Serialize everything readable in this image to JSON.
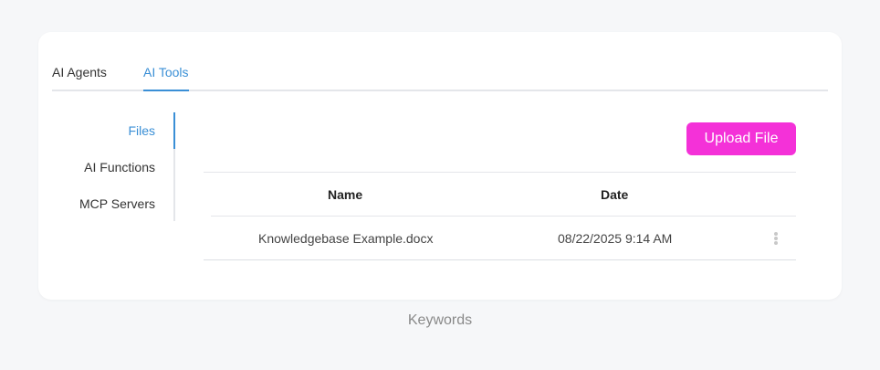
{
  "tabs": [
    {
      "label": "AI Agents",
      "active": false
    },
    {
      "label": "AI Tools",
      "active": true
    }
  ],
  "side_nav": {
    "items": [
      {
        "label": "Files",
        "active": true
      },
      {
        "label": "AI Functions",
        "active": false
      },
      {
        "label": "MCP Servers",
        "active": false
      }
    ]
  },
  "toolbar": {
    "upload_label": "Upload File"
  },
  "table": {
    "columns": [
      "Name",
      "Date"
    ],
    "rows": [
      {
        "name": "Knowledgebase Example.docx",
        "date": "08/22/2025 9:14 AM",
        "menu_icon": "vertical-ellipsis-icon"
      }
    ]
  },
  "footer": {
    "label": "Keywords"
  },
  "colors": {
    "accent": "#3a8fd6",
    "upload_button": "#f431d8",
    "background": "#f6f7f9"
  }
}
